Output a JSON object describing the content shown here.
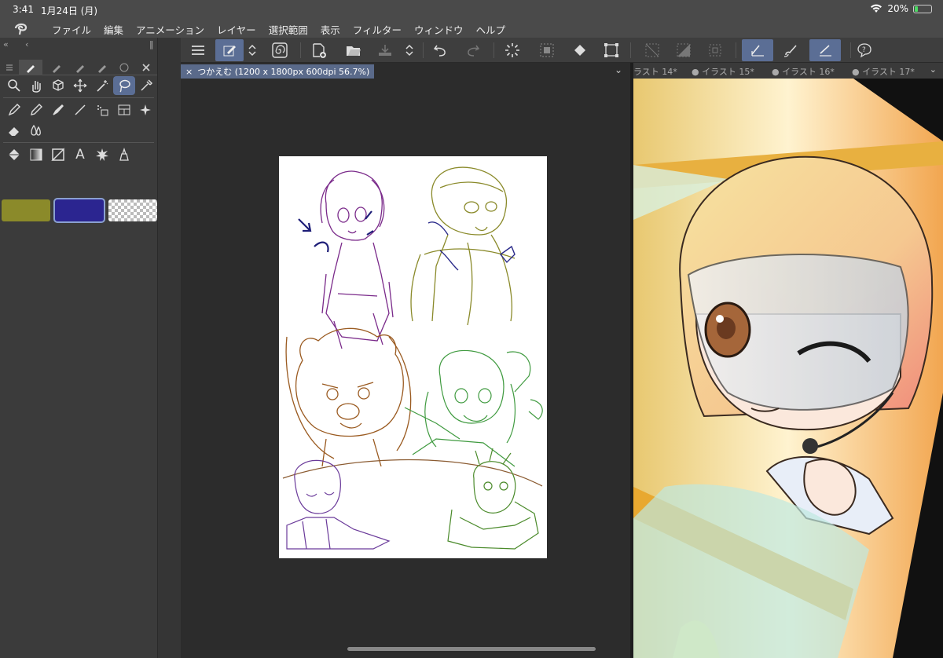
{
  "status": {
    "time": "3:41",
    "date": "1月24日 (月)",
    "battery": "20%",
    "battery_level": 0.2
  },
  "menu": {
    "items": [
      "ファイル",
      "編集",
      "アニメーション",
      "レイヤー",
      "選択範囲",
      "表示",
      "フィルター",
      "ウィンドウ",
      "ヘルプ"
    ]
  },
  "document": {
    "tab_title": "つかえむ (1200 x 1800px 600dpi 56.7%)"
  },
  "right_tabs": [
    "ラスト 14*",
    "● イラスト 15*",
    "● イラスト 16*",
    "● イラスト 17*"
  ],
  "colors": {
    "main": "#8b8a2a",
    "sub": "#2b2590",
    "accent": "#5b6e95"
  },
  "icons": {
    "toolbar": [
      "menu-icon",
      "edit-icon",
      "updown-icon",
      "spiral-icon",
      "new-file-icon",
      "open-folder-icon",
      "save-icon",
      "updown-icon",
      "undo-icon",
      "redo-icon",
      "loading-icon",
      "select-icon",
      "fill-icon",
      "crop-icon",
      "deselect-icon",
      "invert-icon",
      "transform-icon",
      "pen-active-icon",
      "brush-icon",
      "line-active-icon",
      "help-icon"
    ]
  }
}
